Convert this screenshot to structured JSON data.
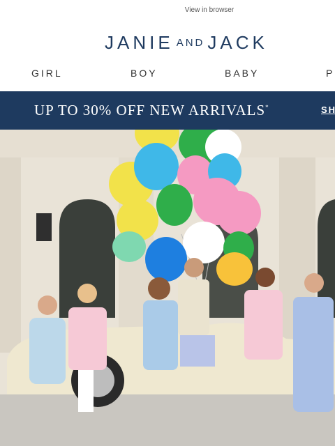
{
  "header": {
    "view_in_browser": "View in browser",
    "logo_main_left": "JANIE",
    "logo_and": "AND",
    "logo_main_right": "JACK"
  },
  "nav": {
    "items": [
      {
        "label": "GIRL"
      },
      {
        "label": "BOY"
      },
      {
        "label": "BABY"
      },
      {
        "label": "P"
      }
    ]
  },
  "promo": {
    "text": "UP TO 30% OFF NEW ARRIVALS",
    "asterisk": "*",
    "cta": "SH",
    "background": "#1e3a5f"
  },
  "hero": {
    "description_icon": "hero-photo",
    "balloon_colors": [
      "#f2e24a",
      "#3fb8e8",
      "#2fae4a",
      "#f59ac2",
      "#8fd14f",
      "#ffffff",
      "#1e7fe0",
      "#f8c23a",
      "#7fd8b0"
    ]
  }
}
